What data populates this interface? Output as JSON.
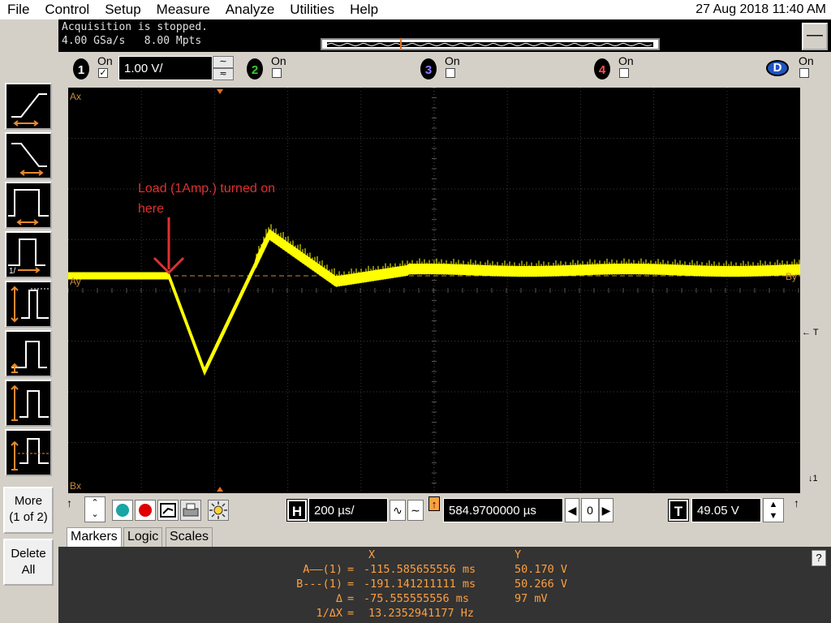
{
  "menu": {
    "items": [
      "File",
      "Control",
      "Setup",
      "Measure",
      "Analyze",
      "Utilities",
      "Help"
    ],
    "datetime": "27 Aug 2018 11:40 AM"
  },
  "status": {
    "line1": "Acquisition is stopped.",
    "line2": "4.00 GSa/s   8.00 Mpts",
    "minimize_label": "—"
  },
  "channels": {
    "ch1": {
      "number": "1",
      "on_label": "On",
      "checked": "✓",
      "scale": "1.00 V/",
      "color": "#ffff00"
    },
    "ch2": {
      "number": "2",
      "on_label": "On",
      "color": "#33cc33"
    },
    "ch3": {
      "number": "3",
      "on_label": "On",
      "color": "#6a5acd"
    },
    "ch4": {
      "number": "4",
      "on_label": "On",
      "color": "#e03030"
    },
    "chD": {
      "number": "D",
      "on_label": "On",
      "color": "#2a6bd6"
    }
  },
  "screen": {
    "label_ax": "Ax",
    "label_bx": "Bx",
    "label_ay": "Ay",
    "label_by": "By",
    "trigger_label": "← T",
    "ground_label": "1",
    "annotation_line1": "Load (1Amp.) turned on",
    "annotation_line2": "here",
    "annotation_color": "#e03030",
    "trace_color": "#ffff00"
  },
  "timebase": {
    "h_letter": "H",
    "time_scale": "200 µs/",
    "delay": "584.9700000 µs",
    "delay_zero": "0",
    "t_letter": "T",
    "trigger_level": "49.05 V"
  },
  "tabs": [
    "Markers",
    "Logic",
    "Scales"
  ],
  "markers": {
    "header_x": "X",
    "header_y": "Y",
    "rows": [
      {
        "label": "A——(1)",
        "eq": "=",
        "x": "-115.585655556 ms",
        "y": "50.170 V"
      },
      {
        "label": "B---(1)",
        "eq": "=",
        "x": "-191.141211111 ms",
        "y": "50.266 V"
      },
      {
        "label": "Δ",
        "eq": "=",
        "x": "-75.555555556 ms",
        "y": "97 mV"
      },
      {
        "label": "1/ΔX",
        "eq": "=",
        "x": "13.2352941177 Hz",
        "y": ""
      }
    ],
    "help_label": "?"
  },
  "left": {
    "more_line1": "More",
    "more_line2": "(1 of 2)",
    "delete_line1": "Delete",
    "delete_line2": "All",
    "icons": [
      "rising-edge-trigger-icon",
      "falling-edge-trigger-icon",
      "pulse-width-trigger-icon",
      "nth-edge-trigger-icon",
      "runt-trigger-icon",
      "setup-hold-trigger-icon",
      "transition-trigger-icon",
      "timeout-trigger-icon"
    ]
  }
}
